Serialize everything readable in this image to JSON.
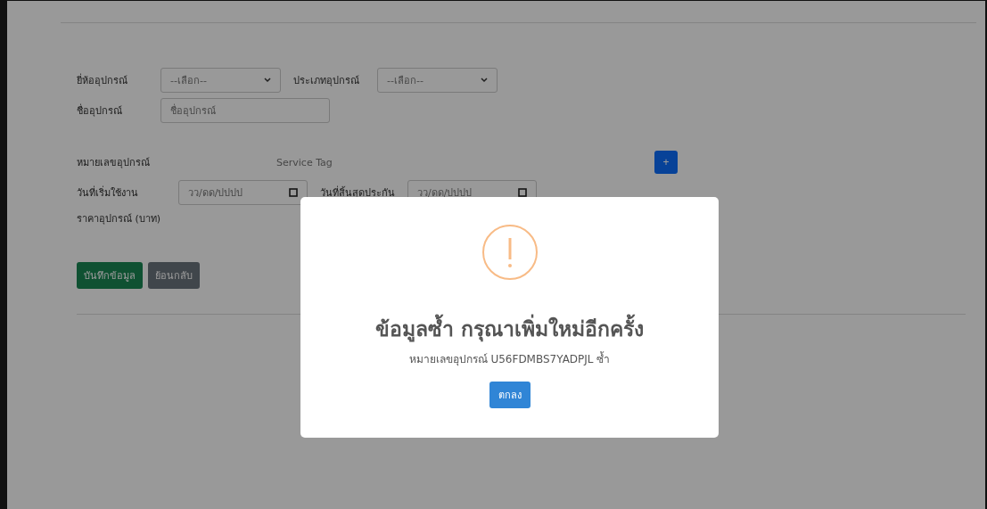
{
  "form": {
    "row_1": [
      {
        "label": "ยี่ห้ออุปกรณ์",
        "kind": "select",
        "value": "--เลือก--"
      },
      {
        "label": "ประเภทอุปกรณ์",
        "kind": "select",
        "value": "--เลือก--"
      }
    ],
    "row_2": [
      {
        "label": "ชื่ออุปกรณ์",
        "kind": "text",
        "placeholder": "ชื่ออุปกรณ์"
      }
    ],
    "serial": {
      "label": "หมายเลขอุปกรณ์",
      "placeholder": "Service Tag",
      "add_button": "+"
    },
    "row_4": [
      {
        "label": "วันที่เริ่มใช้งาน",
        "kind": "date",
        "placeholder": "วว/ดด/ปปปป"
      },
      {
        "label": "วันที่สิ้นสุดประกัน",
        "kind": "date",
        "placeholder": "วว/ดด/ปปปป"
      }
    ],
    "price": {
      "label": "ราคาอุปกรณ์ (บาท)"
    },
    "buttons": [
      {
        "label": "บันทึกข้อมูล",
        "kind": "primary"
      },
      {
        "label": "ย้อนกลับ",
        "kind": "secondary"
      }
    ]
  },
  "dialog": {
    "title": "ข้อมูลซ้ำ กรุณาเพิ่มใหม่อีกครั้ง",
    "message": "หมายเลขอุปกรณ์ U56FDMBS7YADPJL ซ้ำ",
    "confirm": "ตกลง"
  }
}
